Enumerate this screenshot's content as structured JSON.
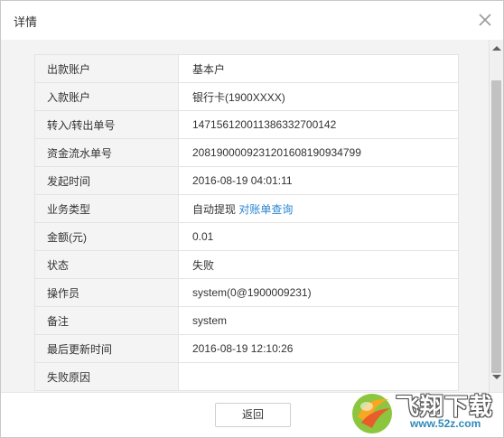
{
  "dialog": {
    "title": "详情"
  },
  "details": {
    "rows": [
      {
        "label": "出款账户",
        "value": "基本户"
      },
      {
        "label": "入款账户",
        "value": "银行卡(1900XXXX)"
      },
      {
        "label": "转入/转出单号",
        "value": "1471561200113863327001​42"
      },
      {
        "label": "资金流水单号",
        "value": "20819000092312016081909​34799"
      },
      {
        "label": "发起时间",
        "value": "2016-08-19 04:01:11"
      },
      {
        "label": "业务类型",
        "value": "自动提现",
        "link": "对账单查询"
      },
      {
        "label": "金额(元)",
        "value": "0.01"
      },
      {
        "label": "状态",
        "value": "失败"
      },
      {
        "label": "操作员",
        "value": "system(0@1900009231)"
      },
      {
        "label": "备注",
        "value": "system"
      },
      {
        "label": "最后更新时间",
        "value": "2016-08-19 12:10:26"
      },
      {
        "label": "失败原因",
        "value": ""
      }
    ]
  },
  "footer": {
    "back_label": "返回"
  },
  "watermark": {
    "name": "飞翔下载",
    "url": "www.52z.com"
  },
  "colors": {
    "link": "#2a86d3",
    "fail": "#e84b4b",
    "label_bg": "#f4f4f4"
  }
}
